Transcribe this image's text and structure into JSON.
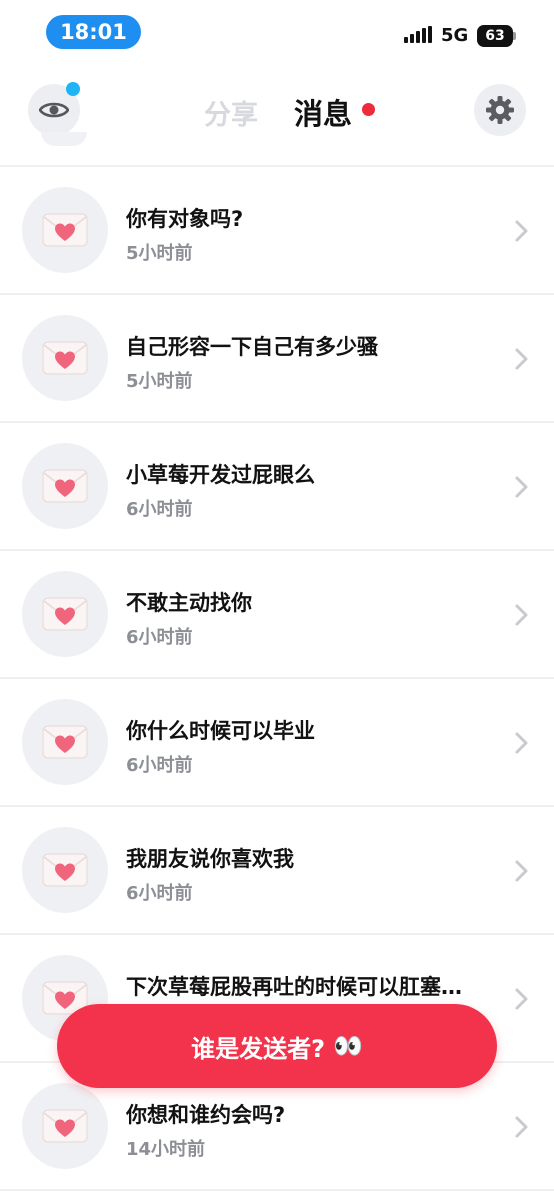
{
  "status_bar": {
    "time": "18:01",
    "network": "5G",
    "battery": "63"
  },
  "header": {
    "tab_share": "分享",
    "tab_messages": "消息",
    "eye_icon": "eye-icon",
    "settings_icon": "gear-icon"
  },
  "messages": [
    {
      "title": "你有对象吗?",
      "time": "5小时前"
    },
    {
      "title": "自己形容一下自己有多少骚",
      "time": "5小时前"
    },
    {
      "title": "小草莓开发过屁眼么",
      "time": "6小时前"
    },
    {
      "title": "不敢主动找你",
      "time": "6小时前"
    },
    {
      "title": "你什么时候可以毕业",
      "time": "6小时前"
    },
    {
      "title": "我朋友说你喜欢我",
      "time": "6小时前"
    },
    {
      "title": "下次草莓屁股再吐的时候可以肛塞…",
      "time": ""
    },
    {
      "title": "你想和谁约会吗?",
      "time": "14小时前"
    }
  ],
  "cta": {
    "label": "谁是发送者?",
    "emoji": "👀"
  },
  "colors": {
    "accent_blue": "#1e8ff0",
    "cta_red": "#f2334b",
    "badge_red": "#ee2b39"
  }
}
